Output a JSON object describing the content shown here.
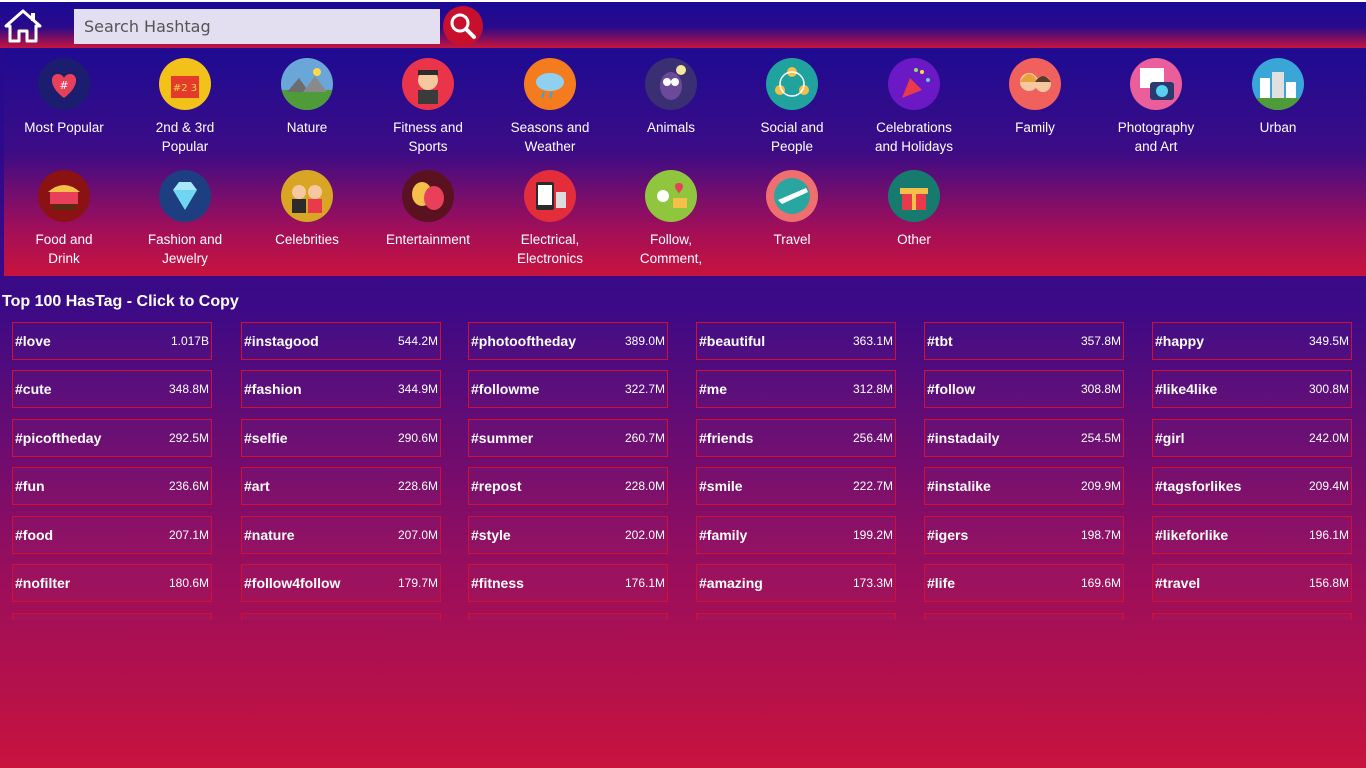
{
  "search": {
    "placeholder": "Search Hashtag"
  },
  "categories": [
    {
      "label": "Most Popular",
      "icon": "heart-hashtag-icon",
      "color": "#1b1e6e"
    },
    {
      "label": "2nd & 3rd\nPopular",
      "icon": "ranking-icon",
      "color": "#f2c21b"
    },
    {
      "label": "Nature",
      "icon": "landscape-icon",
      "color": "#6aa7d8"
    },
    {
      "label": "Fitness and\nSports",
      "icon": "athlete-icon",
      "color": "#e9344a"
    },
    {
      "label": "Seasons and\nWeather",
      "icon": "rain-cloud-icon",
      "color": "#f57c1e"
    },
    {
      "label": "Animals",
      "icon": "owl-icon",
      "color": "#3a2f72"
    },
    {
      "label": "Social and\nPeople",
      "icon": "people-network-icon",
      "color": "#20a39e"
    },
    {
      "label": "Celebrations\nand Holidays",
      "icon": "party-popper-icon",
      "color": "#6a19c4"
    },
    {
      "label": "Family",
      "icon": "family-icon",
      "color": "#f0605d"
    },
    {
      "label": "Photography\nand Art",
      "icon": "camera-icon",
      "color": "#ea5f9b"
    },
    {
      "label": "Urban",
      "icon": "city-icon",
      "color": "#3aa6d8"
    },
    {
      "label": "Food and\nDrink",
      "icon": "food-stall-icon",
      "color": "#8b1212"
    },
    {
      "label": "Fashion and\nJewelry",
      "icon": "diamond-icon",
      "color": "#1e3e82"
    },
    {
      "label": "Celebrities",
      "icon": "celebrity-icon",
      "color": "#d8a624"
    },
    {
      "label": "Entertainment",
      "icon": "theater-masks-icon",
      "color": "#5a1220"
    },
    {
      "label": "Electrical,\nElectronics",
      "icon": "devices-icon",
      "color": "#e42d3a"
    },
    {
      "label": "Follow,\nComment,",
      "icon": "follow-comment-icon",
      "color": "#8fc63e"
    },
    {
      "label": "Travel",
      "icon": "airplane-globe-icon",
      "color": "#ef6f6f"
    },
    {
      "label": "Other",
      "icon": "gift-icon",
      "color": "#177a6e"
    }
  ],
  "section_title": "Top 100 HasTag - Click to Copy",
  "colors": {
    "accent": "#c8102e",
    "tag_border": "#d01035"
  },
  "hashtags": [
    {
      "name": "#love",
      "count": "1.017B"
    },
    {
      "name": "#instagood",
      "count": "544.2M"
    },
    {
      "name": "#photooftheday",
      "count": "389.0M"
    },
    {
      "name": "#beautiful",
      "count": "363.1M"
    },
    {
      "name": "#tbt",
      "count": "357.8M"
    },
    {
      "name": "#happy",
      "count": "349.5M"
    },
    {
      "name": "#cute",
      "count": "348.8M"
    },
    {
      "name": "#fashion",
      "count": "344.9M"
    },
    {
      "name": "#followme",
      "count": "322.7M"
    },
    {
      "name": "#me",
      "count": "312.8M"
    },
    {
      "name": "#follow",
      "count": "308.8M"
    },
    {
      "name": "#like4like",
      "count": "300.8M"
    },
    {
      "name": "#picoftheday",
      "count": "292.5M"
    },
    {
      "name": "#selfie",
      "count": "290.6M"
    },
    {
      "name": "#summer",
      "count": "260.7M"
    },
    {
      "name": "#friends",
      "count": "256.4M"
    },
    {
      "name": "#instadaily",
      "count": "254.5M"
    },
    {
      "name": "#girl",
      "count": "242.0M"
    },
    {
      "name": "#fun",
      "count": "236.6M"
    },
    {
      "name": "#art",
      "count": "228.6M"
    },
    {
      "name": "#repost",
      "count": "228.0M"
    },
    {
      "name": "#smile",
      "count": "222.7M"
    },
    {
      "name": "#instalike",
      "count": "209.9M"
    },
    {
      "name": "#tagsforlikes",
      "count": "209.4M"
    },
    {
      "name": "#food",
      "count": "207.1M"
    },
    {
      "name": "#nature",
      "count": "207.0M"
    },
    {
      "name": "#style",
      "count": "202.0M"
    },
    {
      "name": "#family",
      "count": "199.2M"
    },
    {
      "name": "#igers",
      "count": "198.7M"
    },
    {
      "name": "#likeforlike",
      "count": "196.1M"
    },
    {
      "name": "#nofilter",
      "count": "180.6M"
    },
    {
      "name": "#follow4follow",
      "count": "179.7M"
    },
    {
      "name": "#fitness",
      "count": "176.1M"
    },
    {
      "name": "#amazing",
      "count": "173.3M"
    },
    {
      "name": "#life",
      "count": "169.6M"
    },
    {
      "name": "#travel",
      "count": "156.8M"
    }
  ]
}
